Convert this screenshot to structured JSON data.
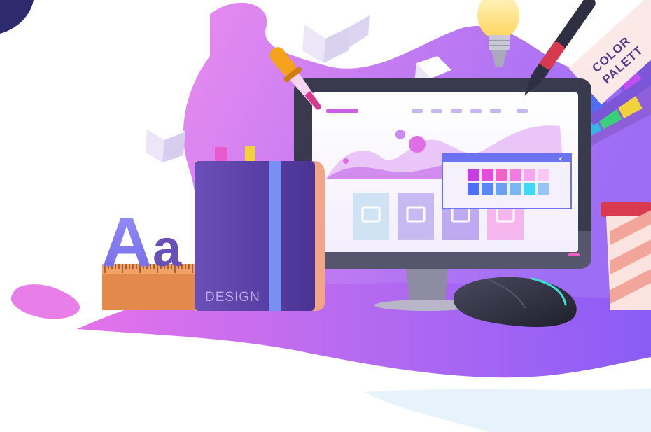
{
  "illustration": {
    "subject": "web design workspace",
    "notebook_label": "DESIGN",
    "palette_card_label_line1": "COLOR",
    "palette_card_label_line2": "PALETT",
    "typography_letters": "Aa",
    "close_glyph": "×",
    "colors": {
      "blob_pink": "#e879e8",
      "blob_purple": "#a55cf0",
      "monitor_frame": "#3a3a4f",
      "screen_bg": "#ffffff",
      "notebook": "#5b3fa0",
      "mouse": "#2e2e3e",
      "swatch_row1": [
        "#c23fe0",
        "#e14fd8",
        "#f063c9",
        "#f27be0",
        "#f6a6ef",
        "#f8c9f5"
      ],
      "swatch_row2": [
        "#4f6ef7",
        "#5a86f5",
        "#6a9ff2",
        "#7bb6f2",
        "#40d8f5",
        "#9ac2f2"
      ]
    }
  }
}
